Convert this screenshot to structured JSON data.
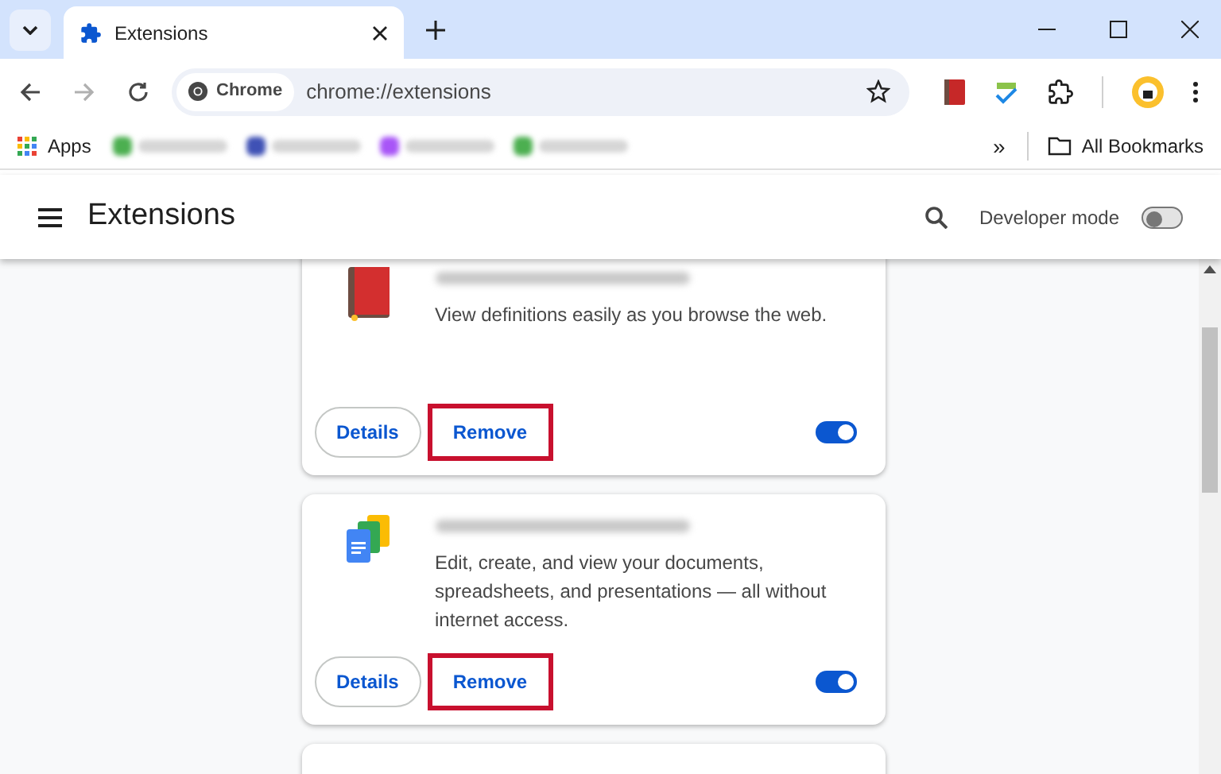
{
  "tabs": [
    {
      "title": "Extensions",
      "selected": true
    }
  ],
  "address_bar": {
    "chip": "Chrome",
    "url": "chrome://extensions"
  },
  "bookmarks": {
    "apps": "Apps",
    "items": [
      {
        "color": "#4caf50"
      },
      {
        "color": "#3f51b5"
      },
      {
        "color": "#a855f7"
      },
      {
        "color": "#4caf50"
      }
    ],
    "overflow": "»",
    "all": "All Bookmarks"
  },
  "header": {
    "title": "Extensions",
    "developer_mode": {
      "label": "Developer mode",
      "on": false
    }
  },
  "extensions": [
    {
      "kind": "dictionary",
      "description": "View definitions easily as you browse the web.",
      "enabled": true,
      "remove_highlighted": true,
      "details": "Details",
      "remove": "Remove"
    },
    {
      "kind": "docs",
      "description": "Edit, create, and view your documents, spreadsheets, and presentations — all without internet access.",
      "enabled": true,
      "remove_highlighted": true,
      "details": "Details",
      "remove": "Remove"
    },
    {
      "kind": "empty"
    }
  ]
}
